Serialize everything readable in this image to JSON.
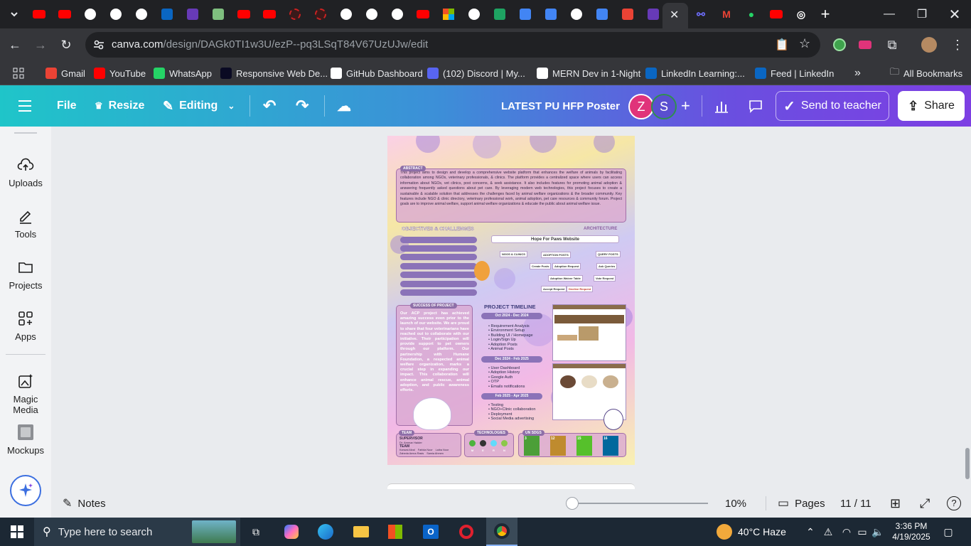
{
  "browser": {
    "tabs": [
      {
        "icon": "youtube-icon",
        "color": "#ff0000"
      },
      {
        "icon": "youtube-icon",
        "color": "#ff0000"
      },
      {
        "icon": "github-icon",
        "color": "#ffffff"
      },
      {
        "icon": "github-icon",
        "color": "#ffffff"
      },
      {
        "icon": "github-icon",
        "color": "#ffffff"
      },
      {
        "icon": "linkedin-icon",
        "color": "#0a66c2"
      },
      {
        "icon": "forms-icon",
        "color": "#673ab7"
      },
      {
        "icon": "notes-icon",
        "color": "#7fbf7f"
      },
      {
        "icon": "youtube-icon",
        "color": "#ff0000"
      },
      {
        "icon": "youtube-icon",
        "color": "#ff0000"
      },
      {
        "icon": "record-icon",
        "color": "#cc2222"
      },
      {
        "icon": "record-icon",
        "color": "#cc2222"
      },
      {
        "icon": "github-icon",
        "color": "#ffffff"
      },
      {
        "icon": "github-icon",
        "color": "#ffffff"
      },
      {
        "icon": "github-icon",
        "color": "#ffffff"
      },
      {
        "icon": "youtube-icon",
        "color": "#ff0000"
      },
      {
        "icon": "microsoft-icon",
        "color": "#f25022"
      },
      {
        "icon": "github-icon",
        "color": "#ffffff"
      },
      {
        "icon": "sheets-plus-icon",
        "color": "#1ea362"
      },
      {
        "icon": "docs-icon",
        "color": "#4285f4"
      },
      {
        "icon": "docs-icon",
        "color": "#4285f4"
      },
      {
        "icon": "chatgpt-icon",
        "color": "#ffffff"
      },
      {
        "icon": "docs-icon",
        "color": "#4285f4"
      },
      {
        "icon": "gmail-icon",
        "color": "#ea4335"
      },
      {
        "icon": "forms-icon",
        "color": "#673ab7"
      }
    ],
    "url_host": "canva.com",
    "url_path": "/design/DAGk0TI1w3U/ezP--pq3LSqT84V67UzUJw/edit",
    "bookmarks": [
      {
        "label": "Gmail",
        "icon": "gmail-icon",
        "color": "#ea4335"
      },
      {
        "label": "YouTube",
        "icon": "youtube-icon",
        "color": "#ff0000"
      },
      {
        "label": "WhatsApp",
        "icon": "whatsapp-icon",
        "color": "#25d366"
      },
      {
        "label": "Responsive Web De...",
        "icon": "freecodecamp-icon",
        "color": "#0a0a23"
      },
      {
        "label": "GitHub Dashboard",
        "icon": "github-icon",
        "color": "#ffffff"
      },
      {
        "label": "(102) Discord | My...",
        "icon": "discord-icon",
        "color": "#5865f2"
      },
      {
        "label": "MERN Dev in 1-Night",
        "icon": "notion-icon",
        "color": "#ffffff"
      },
      {
        "label": "LinkedIn Learning:...",
        "icon": "linkedin-learning-icon",
        "color": "#0a66c2"
      },
      {
        "label": "Feed | LinkedIn",
        "icon": "linkedin-icon",
        "color": "#0a66c2"
      }
    ],
    "all_bookmarks": "All Bookmarks",
    "overflow": "»"
  },
  "canva": {
    "file": "File",
    "resize": "Resize",
    "editing": "Editing",
    "title": "LATEST PU HFP Poster",
    "avatars": [
      {
        "letter": "Z",
        "color": "#e0337a"
      },
      {
        "letter": "S",
        "color": "#5a4fcf"
      }
    ],
    "send_to_teacher": "Send to teacher",
    "share": "Share",
    "sidebar": [
      {
        "label": "Uploads",
        "icon": "upload-cloud-icon"
      },
      {
        "label": "Tools",
        "icon": "pen-tool-icon"
      },
      {
        "label": "Projects",
        "icon": "folder-icon"
      },
      {
        "label": "Apps",
        "icon": "apps-grid-icon"
      },
      {
        "label": "Magic Media",
        "icon": "magic-media-icon"
      },
      {
        "label": "Mockups",
        "icon": "mockups-icon"
      }
    ],
    "footer": {
      "notes": "Notes",
      "zoom": "10%",
      "zoom_level": 0.0,
      "pages": "Pages",
      "page_count": "11 / 11"
    }
  },
  "poster": {
    "abstract_title": "ABSTRACT",
    "abstract_text": "This project aims to design and develop a comprehensive website platform that enhances the welfare of animals by facilitating collaboration among NGOs, veterinary professionals, & clinics. The platform provides a centralized space where users can access information about NGOs, vet clinics, post concerns, & seek assistance. It also includes features for promoting animal adoption & answering frequently asked questions about pet care. By leveraging modern web technologies, this project focuses to create a sustainable & scalable solution that addresses the challenges faced by animal welfare organizations & the broader community. Key features include NGO & clinic directory, veterinary professional work, animal adoption, pet care resources & community forum. Project goals are to improve animal welfare, support animal welfare organizations & educate the public about animal welfare issue.",
    "objectives_title": "OBJECTIVES & CHALLENGES",
    "architecture_title": "ARCHITECTURE",
    "architecture_root": "Hope For Paws Website",
    "architecture_nodes": [
      "NGOS & CLINICS",
      "ADOPTION POSTS",
      "QUERY POSTS",
      "Create Posts",
      "Adoption Request",
      "Ask Queries",
      "Adoption Waiver Table",
      "Vote Request",
      "Accept Request",
      "Decline Request"
    ],
    "success_title": "SUCCESS OF PROJECT",
    "success_text": "Our ACP project has achieved amazing success even prior to the launch of our website. We are proud to share that four veterinarians have reached out to collaborate with our initiative. Their participation will provide support to pet owners through our platform. Our partnership with Humane Foundation, a respected animal welfare organization, marks a crucial step in expanding our impact. This collaboration will enhance animal rescue, animal adoption, and public awareness efforts.",
    "timeline_title": "PROJECT TIMELINE",
    "timeline": [
      {
        "period": "Oct 2024 - Dec 2024",
        "items": [
          "Requirement Analysis",
          "Environment Setup",
          "Building UI / Homepage",
          "Login/Sign Up",
          "Adoption Posts",
          "Animal Posts"
        ]
      },
      {
        "period": "Dec 2024 - Feb 2025",
        "items": [
          "User Dashboard",
          "Adoption History",
          "Google Auth",
          "OTP",
          "Emails notifications"
        ]
      },
      {
        "period": "Feb 2025 - Apr 2025",
        "items": [
          "Testing",
          "NGO+Clinic collaboration",
          "Deployment",
          "Social Media advertising"
        ]
      }
    ],
    "team_title": "TEAM",
    "supervisor_label": "SUPERVISOR",
    "supervisor_name": "Dr. Ammar Haider",
    "team_label": "TEAM",
    "team_members": [
      "Kanwal Afzal",
      "Fahida Noor",
      "Laiba Noor",
      "Zaheda Amna Rasis",
      "Samia Ahmen"
    ],
    "technologies_title": "TECHNOLOGIES",
    "tech_letters": [
      "M",
      "E",
      "R",
      "N"
    ],
    "sdgs_title": "UN SDGS",
    "sdgs": [
      {
        "num": "3",
        "color": "#4c9f38"
      },
      {
        "num": "12",
        "color": "#bf8b2e"
      },
      {
        "num": "15",
        "color": "#56c02b"
      },
      {
        "num": "16",
        "color": "#00689d"
      }
    ]
  },
  "taskbar": {
    "search_placeholder": "Type here to search",
    "weather": "40°C  Haze",
    "time": "3:36 PM",
    "date": "4/19/2025"
  }
}
